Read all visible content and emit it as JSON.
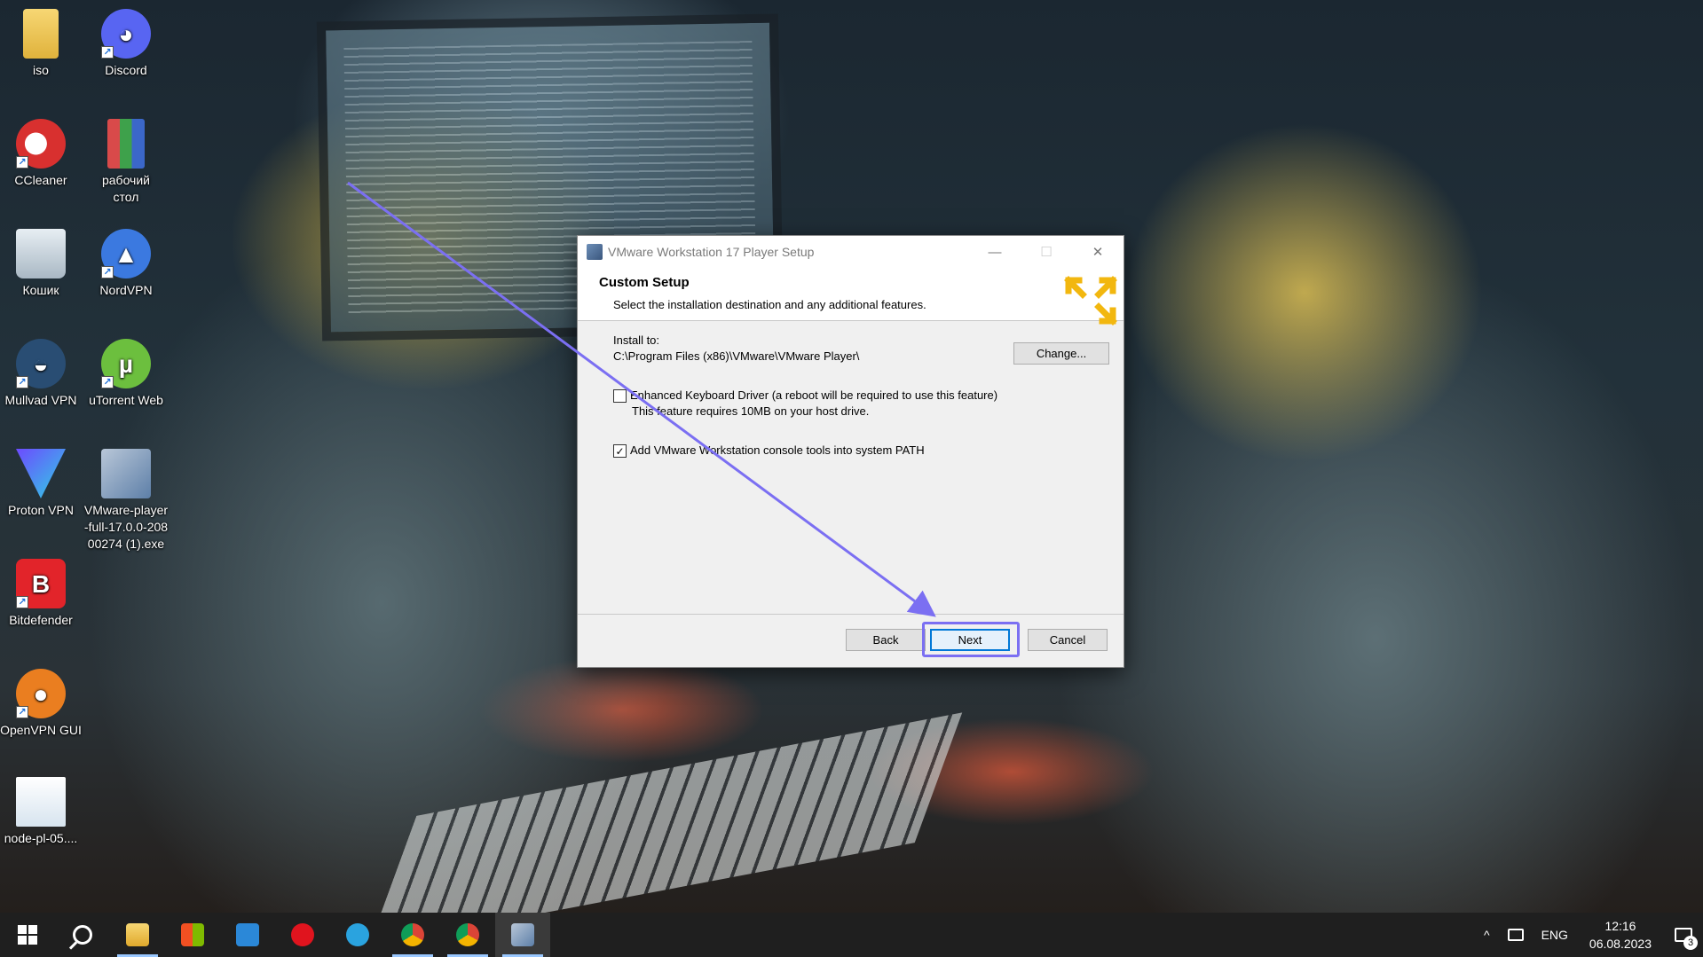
{
  "desktop": {
    "icons": [
      {
        "label": "iso",
        "icon": "folder-icon"
      },
      {
        "label": "Discord",
        "icon": "discord-icon"
      },
      {
        "label": "CCleaner",
        "icon": "ccleaner-icon"
      },
      {
        "label": "рабочий\nстол",
        "icon": "archive-icon"
      },
      {
        "label": "Кошик",
        "icon": "recycle-bin-icon"
      },
      {
        "label": "NordVPN",
        "icon": "nordvpn-icon"
      },
      {
        "label": "Mullvad VPN",
        "icon": "mullvad-icon"
      },
      {
        "label": "uTorrent Web",
        "icon": "utorrent-icon"
      },
      {
        "label": "Proton VPN",
        "icon": "protonvpn-icon"
      },
      {
        "label": "VMware-player-full-17.0.0-20800274 (1).exe",
        "icon": "installer-icon"
      },
      {
        "label": "Bitdefender",
        "icon": "bitdefender-icon"
      },
      {
        "label": "OpenVPN GUI",
        "icon": "openvpn-icon"
      },
      {
        "label": "node-pl-05....",
        "icon": "config-file-icon"
      }
    ],
    "glyphs": {
      "discord": "◕",
      "ccleaner": "C",
      "bitdefender": "B",
      "utorrent": "µ",
      "openvpn": "●",
      "nord": "▲",
      "mullvad": "◒",
      "shortcut": "↗"
    }
  },
  "dialog": {
    "title": "VMware Workstation 17 Player Setup",
    "header_title": "Custom Setup",
    "header_subtitle": "Select the installation destination and any additional features.",
    "install_label": "Install to:",
    "install_path": "C:\\Program Files (x86)\\VMware\\VMware Player\\",
    "change_label": "Change...",
    "option1_label": "Enhanced Keyboard Driver (a reboot will be required to use this feature)",
    "option1_desc": "This feature requires 10MB on your host drive.",
    "option1_checked": false,
    "option2_label": "Add VMware Workstation console tools into system PATH",
    "option2_checked": true,
    "back_label": "Back",
    "next_label": "Next",
    "cancel_label": "Cancel",
    "window_controls": {
      "minimize": "—",
      "maximize": "☐",
      "close": "✕"
    },
    "check_mark": "✓",
    "accent_color": "#0078d7",
    "annotation_color": "#7b6ff2"
  },
  "taskbar": {
    "apps": [
      "start-icon",
      "search-icon",
      "file-explorer-icon",
      "store-icon",
      "mail-icon",
      "opera-icon",
      "telegram-icon",
      "chrome-icon",
      "chrome-profile-icon",
      "vmware-setup-icon"
    ],
    "language": "ENG",
    "time": "12:16",
    "date": "06.08.2023",
    "notification_count": "3",
    "tray_chevron": "^"
  }
}
